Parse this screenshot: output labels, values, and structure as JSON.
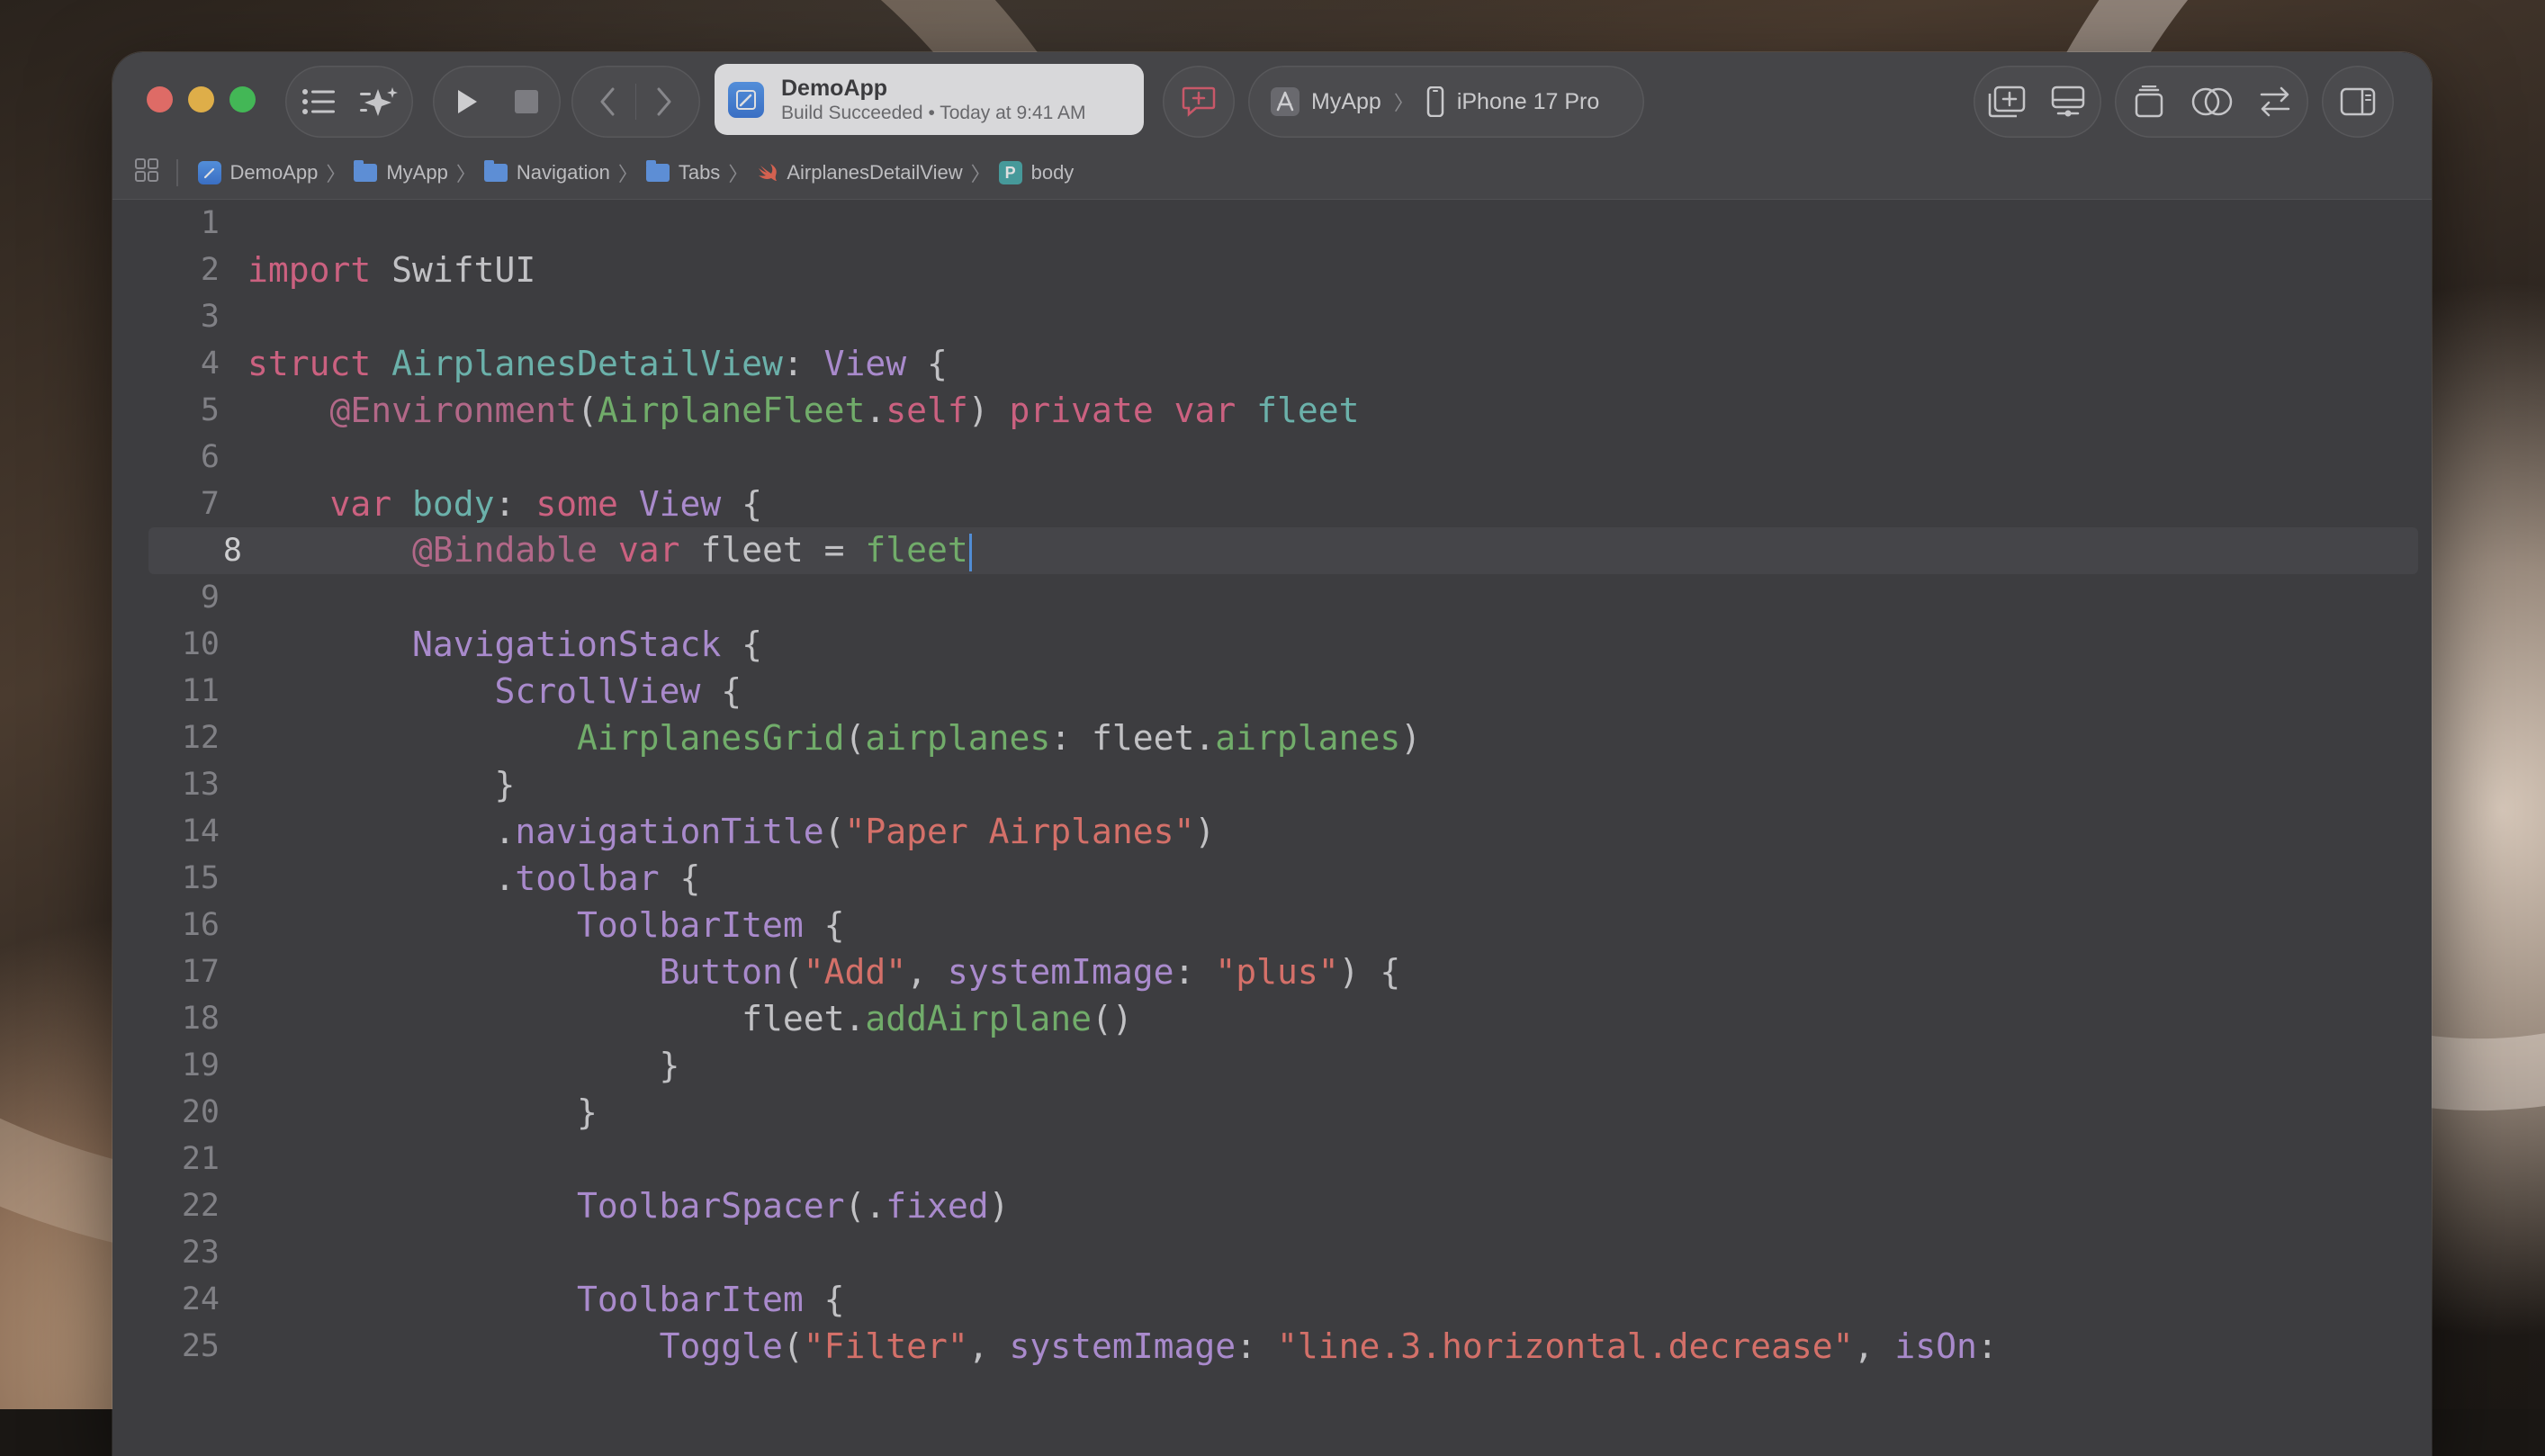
{
  "toolbar": {
    "activity": {
      "title": "DemoApp",
      "subtitle": "Build Succeeded • Today at 9:41 AM"
    },
    "scheme": "MyApp",
    "destination": "iPhone 17 Pro"
  },
  "breadcrumbs": [
    {
      "label": "DemoApp",
      "icon": "project-icon"
    },
    {
      "label": "MyApp",
      "icon": "folder-icon"
    },
    {
      "label": "Navigation",
      "icon": "folder-icon"
    },
    {
      "label": "Tabs",
      "icon": "folder-icon"
    },
    {
      "label": "AirplanesDetailView",
      "icon": "swift-file-icon"
    },
    {
      "label": "body",
      "icon": "property-icon"
    }
  ],
  "editor": {
    "current_line": 8,
    "lines": [
      {
        "n": "1",
        "tokens": []
      },
      {
        "n": "2",
        "tokens": [
          [
            "kw",
            "import"
          ],
          [
            "nm",
            " SwiftUI"
          ]
        ]
      },
      {
        "n": "3",
        "tokens": []
      },
      {
        "n": "4",
        "tokens": [
          [
            "kw",
            "struct"
          ],
          [
            "nm",
            " "
          ],
          [
            "pt",
            "AirplanesDetailView"
          ],
          [
            "nm",
            ": "
          ],
          [
            "ty",
            "View"
          ],
          [
            "nm",
            " {"
          ]
        ]
      },
      {
        "n": "5",
        "tokens": [
          [
            "nm",
            "    "
          ],
          [
            "at",
            "@Environment"
          ],
          [
            "nm",
            "("
          ],
          [
            "pm",
            "AirplaneFleet"
          ],
          [
            "nm",
            "."
          ],
          [
            "kw",
            "self"
          ],
          [
            "nm",
            ") "
          ],
          [
            "kw",
            "private"
          ],
          [
            "nm",
            " "
          ],
          [
            "kw",
            "var"
          ],
          [
            "nm",
            " "
          ],
          [
            "pt",
            "fleet"
          ]
        ]
      },
      {
        "n": "6",
        "tokens": []
      },
      {
        "n": "7",
        "tokens": [
          [
            "nm",
            "    "
          ],
          [
            "kw",
            "var"
          ],
          [
            "nm",
            " "
          ],
          [
            "pt",
            "body"
          ],
          [
            "nm",
            ": "
          ],
          [
            "kw",
            "some"
          ],
          [
            "nm",
            " "
          ],
          [
            "ty",
            "View"
          ],
          [
            "nm",
            " {"
          ]
        ]
      },
      {
        "n": "8",
        "tokens": [
          [
            "nm",
            "        "
          ],
          [
            "at",
            "@Bindable"
          ],
          [
            "nm",
            " "
          ],
          [
            "kw",
            "var"
          ],
          [
            "nm",
            " fleet = "
          ],
          [
            "pm",
            "fleet"
          ]
        ]
      },
      {
        "n": "9",
        "tokens": []
      },
      {
        "n": "10",
        "tokens": [
          [
            "nm",
            "        "
          ],
          [
            "ty",
            "NavigationStack"
          ],
          [
            "nm",
            " {"
          ]
        ]
      },
      {
        "n": "11",
        "tokens": [
          [
            "nm",
            "            "
          ],
          [
            "ty",
            "ScrollView"
          ],
          [
            "nm",
            " {"
          ]
        ]
      },
      {
        "n": "12",
        "tokens": [
          [
            "nm",
            "                "
          ],
          [
            "pm",
            "AirplanesGrid"
          ],
          [
            "nm",
            "("
          ],
          [
            "pm",
            "airplanes"
          ],
          [
            "nm",
            ": fleet."
          ],
          [
            "pm",
            "airplanes"
          ],
          [
            "nm",
            ")"
          ]
        ]
      },
      {
        "n": "13",
        "tokens": [
          [
            "nm",
            "            }"
          ]
        ]
      },
      {
        "n": "14",
        "tokens": [
          [
            "nm",
            "            ."
          ],
          [
            "ty",
            "navigationTitle"
          ],
          [
            "nm",
            "("
          ],
          [
            "st",
            "\"Paper Airplanes\""
          ],
          [
            "nm",
            ")"
          ]
        ]
      },
      {
        "n": "15",
        "tokens": [
          [
            "nm",
            "            ."
          ],
          [
            "ty",
            "toolbar"
          ],
          [
            "nm",
            " {"
          ]
        ]
      },
      {
        "n": "16",
        "tokens": [
          [
            "nm",
            "                "
          ],
          [
            "ty",
            "ToolbarItem"
          ],
          [
            "nm",
            " {"
          ]
        ]
      },
      {
        "n": "17",
        "tokens": [
          [
            "nm",
            "                    "
          ],
          [
            "ty",
            "Button"
          ],
          [
            "nm",
            "("
          ],
          [
            "st",
            "\"Add\""
          ],
          [
            "nm",
            ", "
          ],
          [
            "ty",
            "systemImage"
          ],
          [
            "nm",
            ": "
          ],
          [
            "st",
            "\"plus\""
          ],
          [
            "nm",
            ") {"
          ]
        ]
      },
      {
        "n": "18",
        "tokens": [
          [
            "nm",
            "                        fleet."
          ],
          [
            "pm",
            "addAirplane"
          ],
          [
            "nm",
            "()"
          ]
        ]
      },
      {
        "n": "19",
        "tokens": [
          [
            "nm",
            "                    }"
          ]
        ]
      },
      {
        "n": "20",
        "tokens": [
          [
            "nm",
            "                }"
          ]
        ]
      },
      {
        "n": "21",
        "tokens": []
      },
      {
        "n": "22",
        "tokens": [
          [
            "nm",
            "                "
          ],
          [
            "ty",
            "ToolbarSpacer"
          ],
          [
            "nm",
            "(."
          ],
          [
            "ty",
            "fixed"
          ],
          [
            "nm",
            ")"
          ]
        ]
      },
      {
        "n": "23",
        "tokens": []
      },
      {
        "n": "24",
        "tokens": [
          [
            "nm",
            "                "
          ],
          [
            "ty",
            "ToolbarItem"
          ],
          [
            "nm",
            " {"
          ]
        ]
      },
      {
        "n": "25",
        "tokens": [
          [
            "nm",
            "                    "
          ],
          [
            "ty",
            "Toggle"
          ],
          [
            "nm",
            "("
          ],
          [
            "st",
            "\"Filter\""
          ],
          [
            "nm",
            ", "
          ],
          [
            "ty",
            "systemImage"
          ],
          [
            "nm",
            ": "
          ],
          [
            "st",
            "\"line.3.horizontal.decrease\""
          ],
          [
            "nm",
            ", "
          ],
          [
            "ty",
            "isOn"
          ],
          [
            "nm",
            ":"
          ]
        ]
      }
    ]
  }
}
